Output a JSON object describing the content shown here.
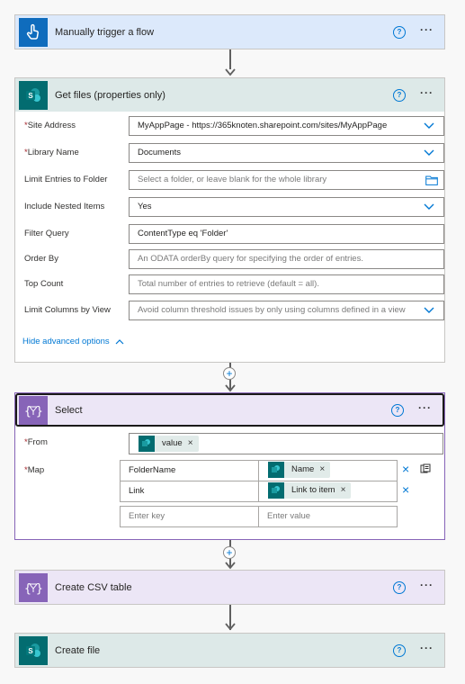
{
  "colors": {
    "trigger_accent": "#0f6cbd",
    "trigger_header": "#dce9fb",
    "sharepoint_accent": "#036c70",
    "sharepoint_header": "#dde9e8",
    "dataop_accent": "#8764b8",
    "dataop_header": "#ece6f6",
    "link_blue": "#0078d4"
  },
  "steps": {
    "trigger": {
      "title": "Manually trigger a flow",
      "icon": "hand-touch-icon"
    },
    "get_files": {
      "title": "Get files (properties only)",
      "icon": "sharepoint-icon",
      "fields": [
        {
          "label": "Site Address",
          "required": true,
          "value": "MyAppPage - https://365knoten.sharepoint.com/sites/MyAppPage",
          "kind": "dropdown"
        },
        {
          "label": "Library Name",
          "required": true,
          "value": "Documents",
          "kind": "dropdown"
        },
        {
          "label": "Limit Entries to Folder",
          "required": false,
          "placeholder": "Select a folder, or leave blank for the whole library",
          "kind": "folder"
        },
        {
          "label": "Include Nested Items",
          "required": false,
          "value": "Yes",
          "kind": "dropdown"
        },
        {
          "label": "Filter Query",
          "required": false,
          "value": "ContentType eq 'Folder'",
          "kind": "text"
        },
        {
          "label": "Order By",
          "required": false,
          "placeholder": "An ODATA orderBy query for specifying the order of entries.",
          "kind": "text"
        },
        {
          "label": "Top Count",
          "required": false,
          "placeholder": "Total number of entries to retrieve (default = all).",
          "kind": "text"
        },
        {
          "label": "Limit Columns by View",
          "required": false,
          "placeholder": "Avoid column threshold issues by only using columns defined in a view",
          "kind": "dropdown"
        }
      ],
      "advanced_toggle": "Hide advanced options"
    },
    "select": {
      "title": "Select",
      "icon": "data-operation-icon",
      "from_label": "From",
      "from_token": "value",
      "map_label": "Map",
      "map_rows": [
        {
          "key": "FolderName",
          "value_token": "Name"
        },
        {
          "key": "Link",
          "value_token": "Link to item"
        }
      ],
      "key_placeholder": "Enter key",
      "value_placeholder": "Enter value"
    },
    "create_csv": {
      "title": "Create CSV table",
      "icon": "data-operation-icon"
    },
    "create_file": {
      "title": "Create file",
      "icon": "sharepoint-icon"
    }
  },
  "help_glyph": "?",
  "more_glyph": "···",
  "plus_glyph": "+",
  "remove_glyph": "×"
}
